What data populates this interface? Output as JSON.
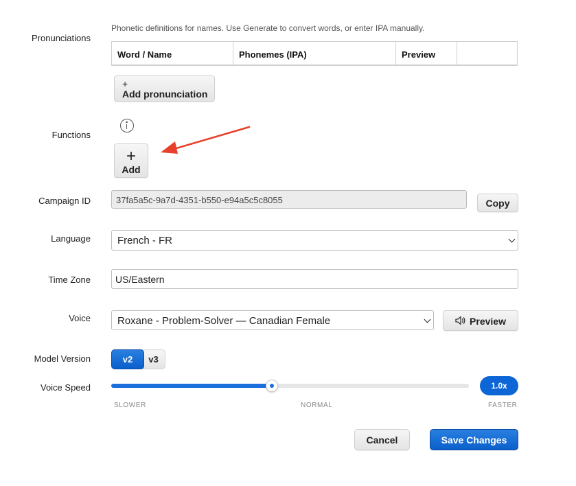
{
  "form": {
    "pronunciations": {
      "label": "Pronunciations",
      "hint": "Phonetic definitions for names. Use Generate to convert words, or enter IPA manually.",
      "columns": [
        "Word / Name",
        "Phonemes (IPA)",
        "Preview",
        ""
      ],
      "add_label": "Add pronunciation",
      "add_icon": "+"
    },
    "functions": {
      "label": "Functions",
      "add_label": "Add",
      "add_icon": "+"
    },
    "campaign_id": {
      "label": "Campaign ID",
      "value": "37fa5a5c-9a7d-4351-b550-e94a5c5c8055",
      "copy_label": "Copy"
    },
    "language": {
      "label": "Language",
      "value": "French - FR"
    },
    "time_zone": {
      "label": "Time Zone",
      "value": "US/Eastern"
    },
    "voice": {
      "label": "Voice",
      "value": "Roxane - Problem-Solver — Canadian Female",
      "preview_label": "Preview"
    },
    "model_version": {
      "label": "Model Version",
      "options": [
        "v2",
        "v3"
      ],
      "selected": "v2"
    },
    "voice_speed": {
      "label": "Voice Speed",
      "value_label": "1.0x",
      "value": 1.0,
      "position_fraction": 0.45,
      "ticks": [
        "SLOWER",
        "NORMAL",
        "FASTER"
      ]
    }
  },
  "actions": {
    "cancel_label": "Cancel",
    "save_label": "Save Changes"
  },
  "colors": {
    "primary": "#0a5fcb",
    "annotation_arrow": "#e8402a"
  }
}
